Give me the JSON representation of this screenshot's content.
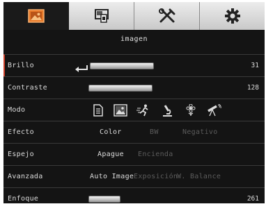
{
  "tabs": [
    {
      "name": "image-tab",
      "icon": "image-icon",
      "active": true
    },
    {
      "name": "display-tab",
      "icon": "display-settings-icon",
      "active": false
    },
    {
      "name": "tools-tab",
      "icon": "tools-icon",
      "active": false
    },
    {
      "name": "settings-tab",
      "icon": "gear-icon",
      "active": false
    }
  ],
  "page_title": "imagen",
  "colors": {
    "active_tab_icon": "#e87a2a",
    "selected_marker": "#d0402a"
  },
  "rows": {
    "brillo": {
      "label": "Brillo",
      "value": "31"
    },
    "contraste": {
      "label": "Contraste",
      "value": "128"
    },
    "modo": {
      "label": "Modo",
      "icons": [
        "document-icon",
        "photo-icon",
        "motion-icon",
        "microscope-icon",
        "flower-icon",
        "telescope-icon"
      ]
    },
    "efecto": {
      "label": "Efecto",
      "options": [
        "Color",
        "BW",
        "Negativo"
      ],
      "selected": "Color"
    },
    "espejo": {
      "label": "Espejo",
      "options": [
        "Apague",
        "Encienda"
      ],
      "selected": "Apague"
    },
    "avanzada": {
      "label": "Avanzada",
      "options": [
        "Auto Image",
        "Exposición",
        "W. Balance"
      ],
      "selected": "Auto Image"
    },
    "enfoque": {
      "label": "Enfoque",
      "value": "261"
    }
  }
}
